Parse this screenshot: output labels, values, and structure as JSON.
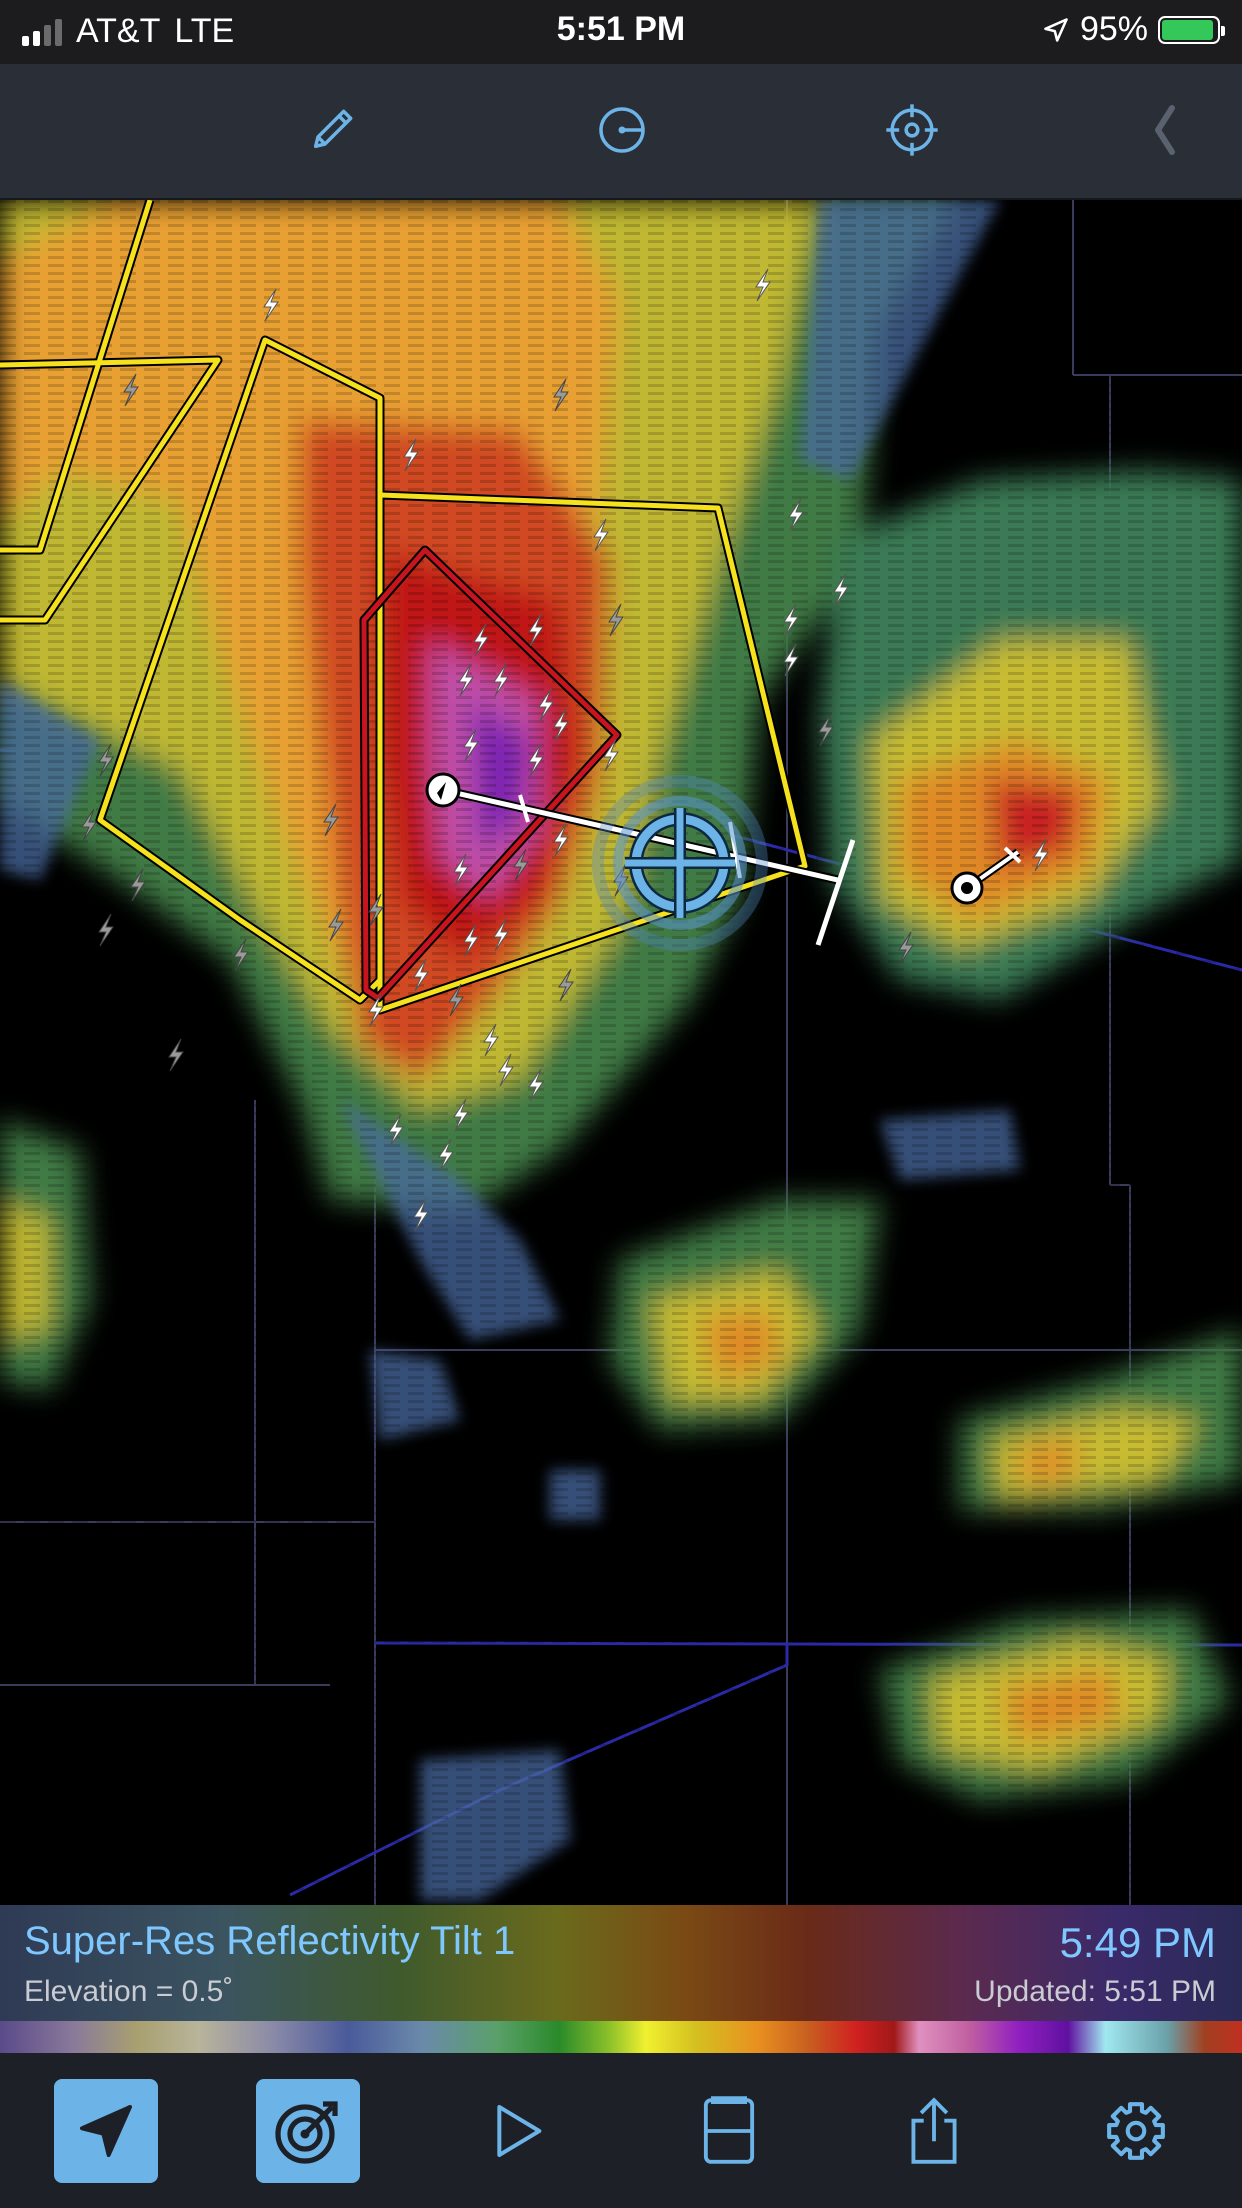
{
  "status_bar": {
    "carrier": "AT&T",
    "network": "LTE",
    "time": "5:51 PM",
    "battery": "95%",
    "battery_level": 0.95,
    "icons": [
      "signal-icon",
      "location-arrow-icon",
      "battery-charging-icon"
    ]
  },
  "toolbar": {
    "items": [
      {
        "name": "draw-tool",
        "icon": "pencil-icon"
      },
      {
        "name": "storm-track-tool",
        "icon": "circle-line-icon"
      },
      {
        "name": "target-tool",
        "icon": "crosshair-icon"
      },
      {
        "name": "collapse-tool",
        "icon": "chevron-left-icon"
      }
    ]
  },
  "legend": {
    "title": "Super-Res Reflectivity Tilt 1",
    "elevation": "Elevation = 0.5˚",
    "time": "5:49 PM",
    "updated": "Updated: 5:51 PM"
  },
  "tab_bar": {
    "items": [
      {
        "name": "location",
        "icon": "location-arrow-icon",
        "active": true
      },
      {
        "name": "radar",
        "icon": "radar-sweep-icon",
        "active": true
      },
      {
        "name": "play",
        "icon": "play-icon",
        "active": false
      },
      {
        "name": "layout",
        "icon": "split-layout-icon",
        "active": false
      },
      {
        "name": "share",
        "icon": "share-icon",
        "active": false
      },
      {
        "name": "settings",
        "icon": "gear-icon",
        "active": false
      }
    ]
  },
  "colors": {
    "accent": "#6cb4e8",
    "warning_yellow": "#f5e21c",
    "warning_red": "#c8141e",
    "county_line": "#3b3b5c",
    "highway_blue": "#2a2aa8"
  }
}
